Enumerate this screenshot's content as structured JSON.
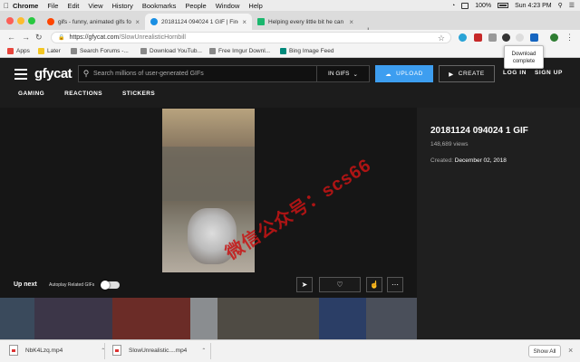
{
  "menubar": {
    "items": [
      "Chrome",
      "File",
      "Edit",
      "View",
      "History",
      "Bookmarks",
      "People",
      "Window",
      "Help"
    ],
    "battery": "100%",
    "clock": "Sun 4:23 PM"
  },
  "tabs": [
    {
      "title": "gifs - funny, animated gifs for...",
      "favicon": "reddit-icon",
      "color": "#ff4500"
    },
    {
      "title": "20181124 094024 1 GIF | Find...",
      "favicon": "gfycat-icon",
      "color": "#1a8fe3"
    },
    {
      "title": "Helping every little bit he can",
      "favicon": "imgur-icon",
      "color": "#1bb76e"
    }
  ],
  "address": {
    "host": "https://gfycat.com",
    "path": "/SlowUnrealisticHornbill"
  },
  "tooltip": {
    "line1": "Download",
    "line2": "complete"
  },
  "bookmarks": [
    {
      "label": "Apps",
      "color": "#e8453c"
    },
    {
      "label": "Later",
      "color": "#f3c623"
    },
    {
      "label": "Search Forums -...",
      "color": "#888888"
    },
    {
      "label": "Download YouTub...",
      "color": "#888888"
    },
    {
      "label": "Free Imgur Downl...",
      "color": "#888888"
    },
    {
      "label": "Bing Image Feed",
      "color": "#00897b"
    }
  ],
  "site": {
    "logo": "gfycat",
    "search_placeholder": "Search millions of user-generated GIFs",
    "search_scope": "IN GIFS",
    "upload_label": "UPLOAD",
    "create_label": "CREATE",
    "login_label": "LOG IN",
    "signup_label": "SIGN UP",
    "nav": [
      "GAMING",
      "REACTIONS",
      "STICKERS"
    ]
  },
  "player": {
    "up_next": "Up next",
    "autoplay_label": "Autoplay Related GIFs"
  },
  "gif_info": {
    "title": "20181124 094024 1 GIF",
    "views": "148,689 views",
    "created_label": "Created:",
    "created_date": "December 02, 2018"
  },
  "thumbnails": [
    {
      "color": "#3a4a5c"
    },
    {
      "color": "#3c3648"
    },
    {
      "color": "#6b2c27"
    },
    {
      "color": "#8a8d90"
    },
    {
      "color": "#4f4b44"
    },
    {
      "color": "#2b3e66"
    },
    {
      "color": "#4a4f5a"
    }
  ],
  "watermark": "微信公众号：scs66",
  "downloads": [
    {
      "filename": "NbK4Lzq.mp4"
    },
    {
      "filename": "SlowUnrealistic....mp4"
    }
  ],
  "download_bar": {
    "show_all": "Show All"
  }
}
